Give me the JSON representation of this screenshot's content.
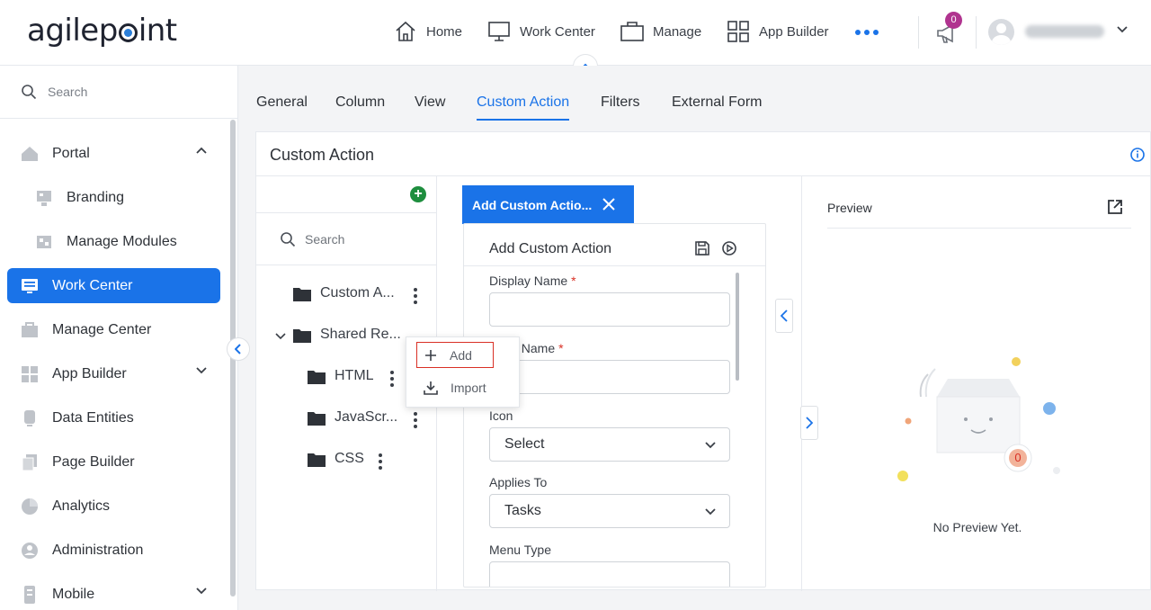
{
  "header": {
    "logo": "agilepoint",
    "nav": [
      {
        "label": "Home",
        "icon": "home-icon"
      },
      {
        "label": "Work Center",
        "icon": "monitor-icon"
      },
      {
        "label": "Manage",
        "icon": "briefcase-icon"
      },
      {
        "label": "App Builder",
        "icon": "grid-icon"
      }
    ],
    "notification_count": "0"
  },
  "sidebar": {
    "search_placeholder": "Search",
    "items": [
      {
        "label": "Portal",
        "icon": "home-icon",
        "expanded": true
      },
      {
        "label": "Branding",
        "icon": "branding-icon"
      },
      {
        "label": "Manage Modules",
        "icon": "modules-icon"
      },
      {
        "label": "Work Center",
        "icon": "monitor-icon",
        "active": true
      },
      {
        "label": "Manage Center",
        "icon": "briefcase-icon"
      },
      {
        "label": "App Builder",
        "icon": "grid-icon",
        "expanded": false
      },
      {
        "label": "Data Entities",
        "icon": "database-icon"
      },
      {
        "label": "Page Builder",
        "icon": "pages-icon"
      },
      {
        "label": "Analytics",
        "icon": "pie-chart-icon"
      },
      {
        "label": "Administration",
        "icon": "admin-icon"
      },
      {
        "label": "Mobile",
        "icon": "mobile-icon",
        "expanded": false
      }
    ]
  },
  "tabs": [
    "General",
    "Column",
    "View",
    "Custom Action",
    "Filters",
    "External Form"
  ],
  "active_tab": "Custom Action",
  "panel": {
    "title": "Custom Action",
    "tree": {
      "search_placeholder": "Search",
      "nodes": [
        {
          "label": "Custom A..."
        },
        {
          "label": "Shared Re..."
        },
        {
          "label": "HTML"
        },
        {
          "label": "JavaScr..."
        },
        {
          "label": "CSS"
        }
      ]
    },
    "context_menu": [
      {
        "label": "Add",
        "icon": "plus-icon"
      },
      {
        "label": "Import",
        "icon": "import-icon"
      }
    ],
    "form": {
      "tab_label": "Add Custom Actio...",
      "title": "Add Custom Action",
      "fields": {
        "display_name": "Display Name",
        "internal_name_partial": "al Name",
        "required_mark": "*",
        "icon_label": "Icon",
        "icon_value": "Select",
        "applies_to_label": "Applies To",
        "applies_to_value": "Tasks",
        "menu_type_label": "Menu Type"
      }
    },
    "preview": {
      "title": "Preview",
      "empty_text": "No Preview Yet.",
      "badge": "0"
    }
  },
  "colors": {
    "accent": "#1a73e8",
    "notification": "#b0338f",
    "add_green": "#1e8e3e",
    "highlight_red": "#d93025"
  }
}
